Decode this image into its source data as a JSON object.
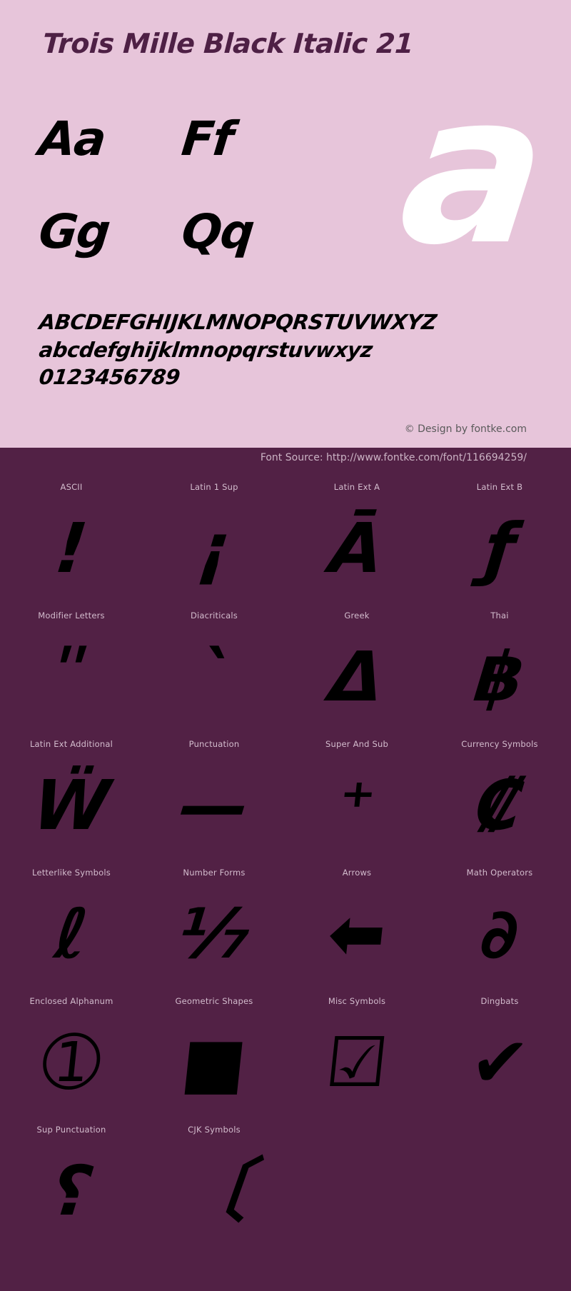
{
  "colors": {
    "panel_bg": "#e7c5da",
    "dark_bg": "#522145",
    "title": "#4e2045",
    "glyph": "#000000",
    "watermark": "#ffffff",
    "label": "#d3bccd",
    "credit": "#5a5a5a"
  },
  "specimen": {
    "title": "Trois Mille Black Italic 21",
    "pairs": [
      {
        "label": "Aa"
      },
      {
        "label": "Ff"
      },
      {
        "label": "Gg"
      },
      {
        "label": "Qq"
      }
    ],
    "watermark_glyph": "a",
    "uppercase": "ABCDEFGHIJKLMNOPQRSTUVWXYZ",
    "lowercase": "abcdefghijklmnopqrstuvwxyz",
    "digits": "0123456789",
    "credit": "© Design by fontke.com"
  },
  "source": {
    "text": "Font Source: http://www.fontke.com/font/116694259/"
  },
  "unicode_blocks": [
    {
      "label": "ASCII",
      "glyph": "!"
    },
    {
      "label": "Latin 1 Sup",
      "glyph": "¡"
    },
    {
      "label": "Latin Ext A",
      "glyph": "Ā"
    },
    {
      "label": "Latin Ext B",
      "glyph": "ƒ"
    },
    {
      "label": "Modifier Letters",
      "glyph": "ʺ"
    },
    {
      "label": "Diacriticals",
      "glyph": "`"
    },
    {
      "label": "Greek",
      "glyph": "Δ"
    },
    {
      "label": "Thai",
      "glyph": "฿"
    },
    {
      "label": "Latin Ext Additional",
      "glyph": "Ẅ"
    },
    {
      "label": "Punctuation",
      "glyph": "—"
    },
    {
      "label": "Super And Sub",
      "glyph": "⁺"
    },
    {
      "label": "Currency Symbols",
      "glyph": "₡"
    },
    {
      "label": "Letterlike Symbols",
      "glyph": "ℓ"
    },
    {
      "label": "Number Forms",
      "glyph": "⅐"
    },
    {
      "label": "Arrows",
      "glyph": "⬅"
    },
    {
      "label": "Math Operators",
      "glyph": "∂"
    },
    {
      "label": "Enclosed Alphanum",
      "glyph": "➀"
    },
    {
      "label": "Geometric Shapes",
      "glyph": "■"
    },
    {
      "label": "Misc Symbols",
      "glyph": "☑"
    },
    {
      "label": "Dingbats",
      "glyph": "✔"
    },
    {
      "label": "Sup Punctuation",
      "glyph": "⸮"
    },
    {
      "label": "CJK Symbols",
      "glyph": "〔"
    }
  ]
}
